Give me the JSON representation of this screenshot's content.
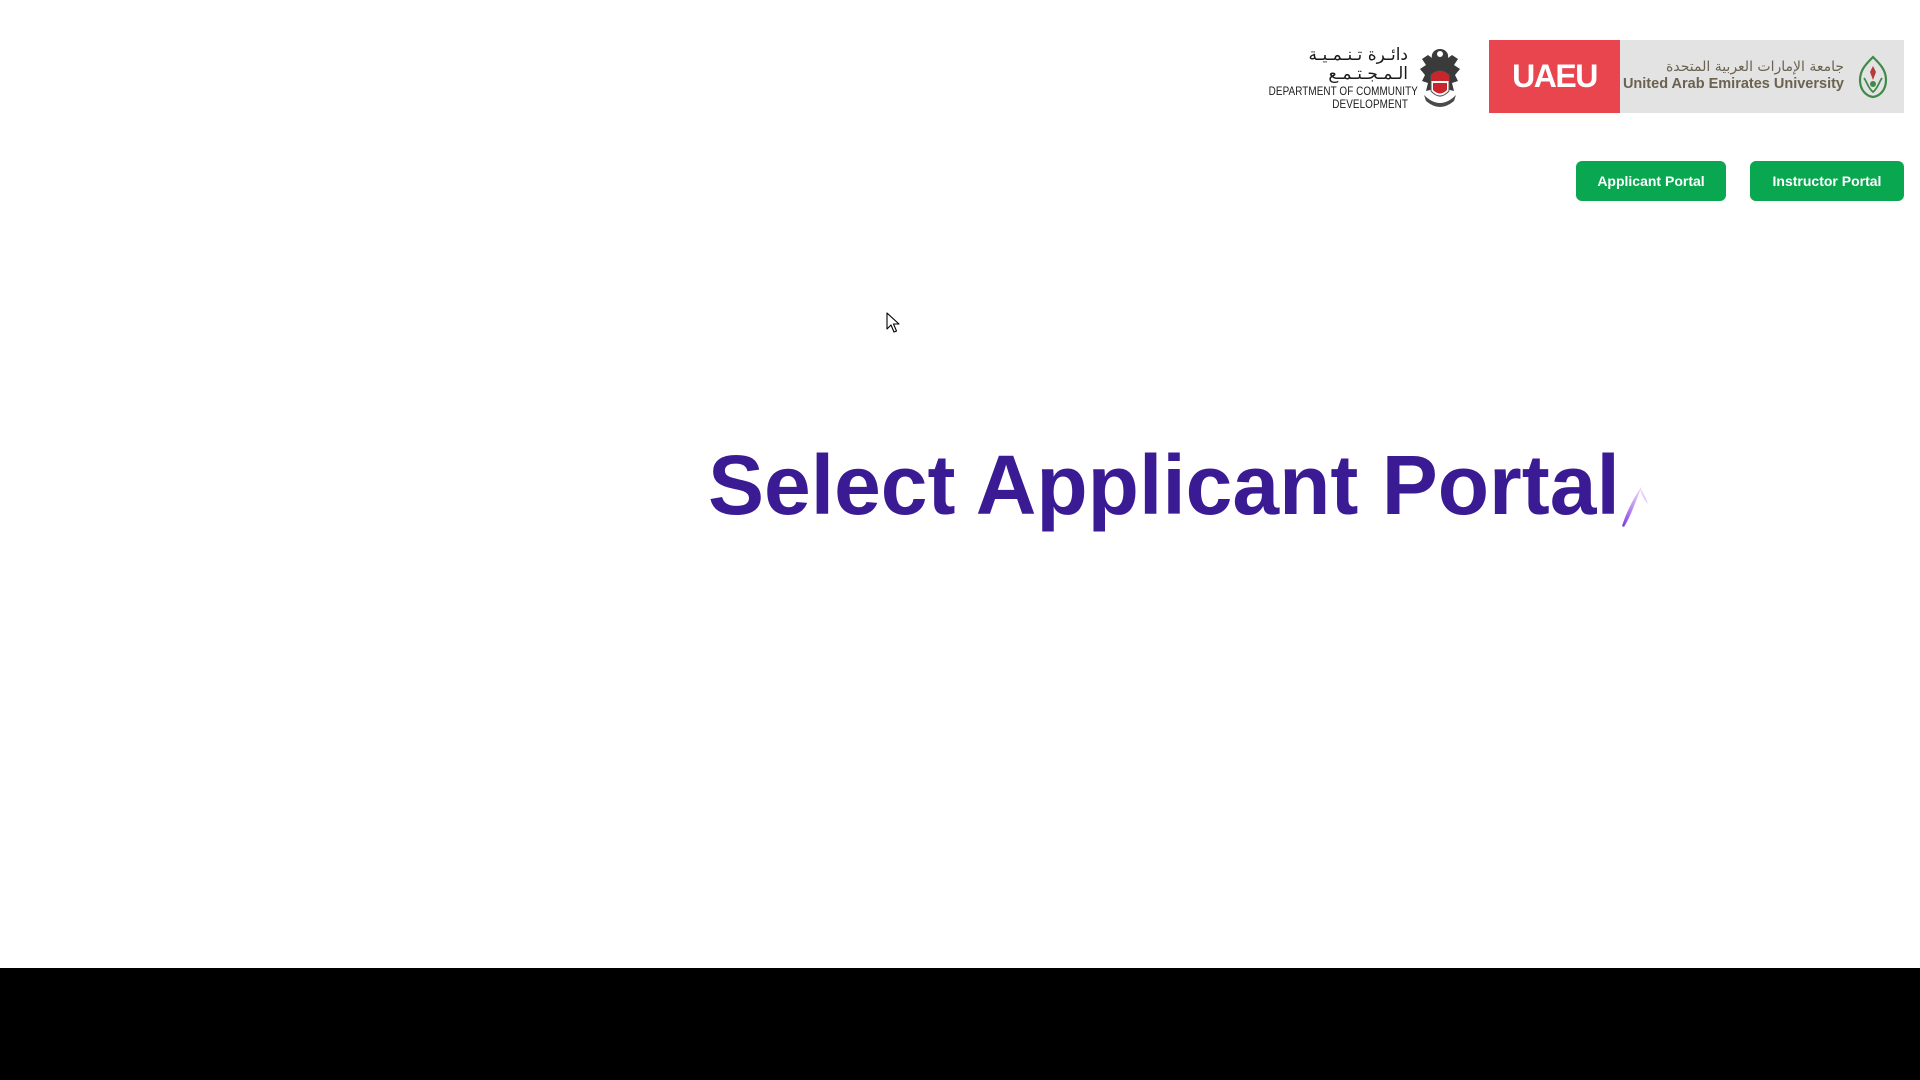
{
  "header": {
    "dcd_logo": {
      "arabic_text": "دائـرة تـنـمـيـة الـمـجـتـمـع",
      "english_line1": "DEPARTMENT OF COMMUNITY",
      "english_line2": "DEVELOPMENT",
      "emblem": "abu-dhabi-falcon-emblem-icon"
    },
    "uaeu_logo": {
      "mark_text": "UAEU",
      "arabic_text": "جامعة الإمارات العربية المتحدة",
      "english_text": "United Arab Emirates University",
      "emblem": "uaeu-crest-icon",
      "mark_color": "#e9454f",
      "panel_color": "#e3e3e3"
    }
  },
  "nav": {
    "applicant_portal_label": "Applicant Portal",
    "instructor_portal_label": "Instructor Portal",
    "button_color": "#0aa751"
  },
  "main": {
    "heading": "Select Applicant Portal",
    "heading_color": "#3b1b94",
    "loading_indicator": "spinner-icon"
  },
  "pointer": "mouse-cursor-icon"
}
